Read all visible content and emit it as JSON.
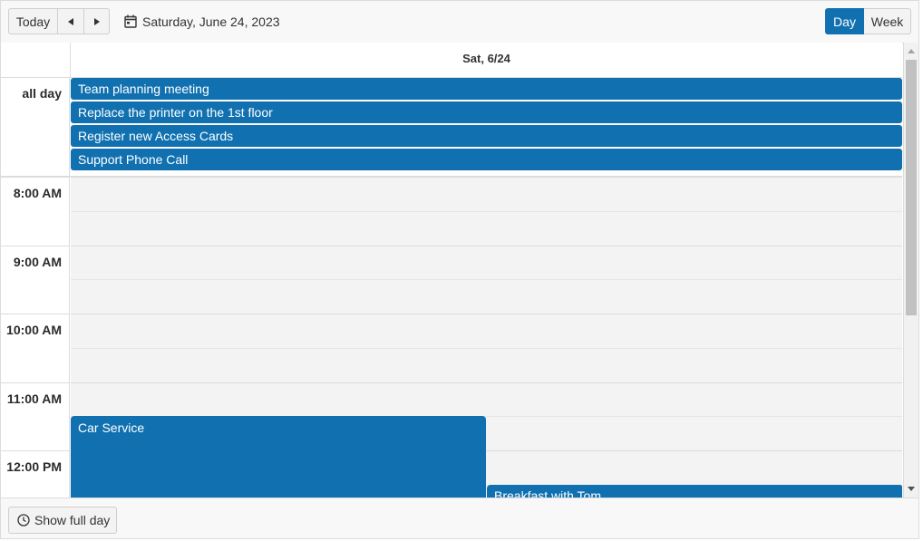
{
  "toolbar": {
    "today_label": "Today",
    "prev_icon": "triangle-left-icon",
    "next_icon": "triangle-right-icon",
    "current_date": "Saturday, June 24, 2023",
    "calendar_icon": "calendar-icon",
    "views": [
      {
        "label": "Day",
        "selected": true
      },
      {
        "label": "Week",
        "selected": false
      }
    ]
  },
  "header": {
    "day_label": "Sat, 6/24"
  },
  "allday": {
    "label": "all day",
    "events": [
      {
        "title": "Team planning meeting"
      },
      {
        "title": "Replace the printer on the 1st floor"
      },
      {
        "title": "Register new Access Cards"
      },
      {
        "title": "Support Phone Call"
      }
    ]
  },
  "grid": {
    "hours": [
      "8:00 AM",
      "9:00 AM",
      "10:00 AM",
      "11:00 AM",
      "12:00 PM"
    ],
    "events": [
      {
        "title": "Car Service"
      },
      {
        "title": "Breakfast with Tom"
      }
    ]
  },
  "footer": {
    "show_full_day_label": "Show full day",
    "clock_icon": "clock-icon"
  },
  "colors": {
    "accent": "#1171b0",
    "slot_bg": "#f3f3f3",
    "border": "#dcdcdc"
  }
}
